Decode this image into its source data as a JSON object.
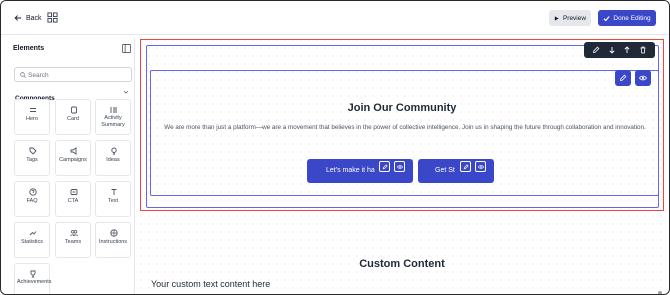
{
  "topbar": {
    "back_label": "Back",
    "preview_label": "Preview",
    "done_label": "Done Editing",
    "accent_color": "#3b47c9"
  },
  "sidebar": {
    "title": "Elements",
    "search_placeholder": "Search",
    "components_label": "Components",
    "tiles": [
      {
        "label": "Hero",
        "icon": "hero-icon"
      },
      {
        "label": "Card",
        "icon": "card-icon"
      },
      {
        "label": "Activity Summary",
        "icon": "activity-icon"
      },
      {
        "label": "Tags",
        "icon": "tag-icon"
      },
      {
        "label": "Campaigns",
        "icon": "megaphone-icon"
      },
      {
        "label": "Ideas",
        "icon": "lightbulb-icon"
      },
      {
        "label": "FAQ",
        "icon": "question-icon"
      },
      {
        "label": "CTA",
        "icon": "cta-icon"
      },
      {
        "label": "Text",
        "icon": "text-icon"
      },
      {
        "label": "Statistics",
        "icon": "trend-icon"
      },
      {
        "label": "Teams",
        "icon": "people-icon"
      },
      {
        "label": "Instructions",
        "icon": "compass-icon"
      },
      {
        "label": "Achievements",
        "icon": "trophy-icon"
      }
    ]
  },
  "canvas": {
    "headline": "Join Our Community",
    "paragraph": "We are more than just a platform—we are a movement that believes in the power of collective intelligence. Join us in shaping the future through collaboration and innovation.",
    "primary_cta": "Let's make it ha",
    "secondary_cta": "Get St",
    "custom_title": "Custom Content",
    "custom_text": "Your custom text content here"
  }
}
